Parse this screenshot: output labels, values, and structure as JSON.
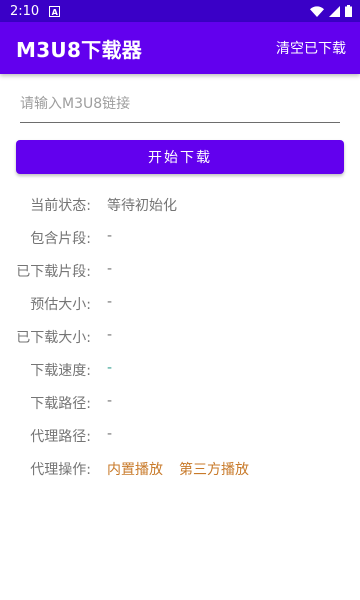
{
  "status_bar": {
    "time": "2:10",
    "notification_icon": "a-box-icon",
    "icons": [
      "wifi-icon",
      "signal-icon",
      "battery-icon"
    ]
  },
  "app_bar": {
    "title": "M3U8下载器",
    "clear_label": "清空已下载"
  },
  "url_input": {
    "placeholder": "请输入M3U8链接",
    "value": ""
  },
  "start_button": {
    "label": "开始下载"
  },
  "info": {
    "status": {
      "label": "当前状态:",
      "value": "等待初始化"
    },
    "segments": {
      "label": "包含片段:",
      "value": "-"
    },
    "downloaded_segments": {
      "label": "已下载片段:",
      "value": "-"
    },
    "estimated_size": {
      "label": "预估大小:",
      "value": "-"
    },
    "downloaded_size": {
      "label": "已下载大小:",
      "value": "-"
    },
    "speed": {
      "label": "下载速度:",
      "value": "-"
    },
    "download_path": {
      "label": "下载路径:",
      "value": "-"
    },
    "proxy_path": {
      "label": "代理路径:",
      "value": "-"
    },
    "proxy_action": {
      "label": "代理操作:",
      "builtin_play": "内置播放",
      "third_party_play": "第三方播放"
    }
  },
  "colors": {
    "status_bar": "#3a00c7",
    "primary": "#6200ee",
    "label_text": "#757575",
    "link": "#c87a2a",
    "speed": "#3aa394"
  }
}
